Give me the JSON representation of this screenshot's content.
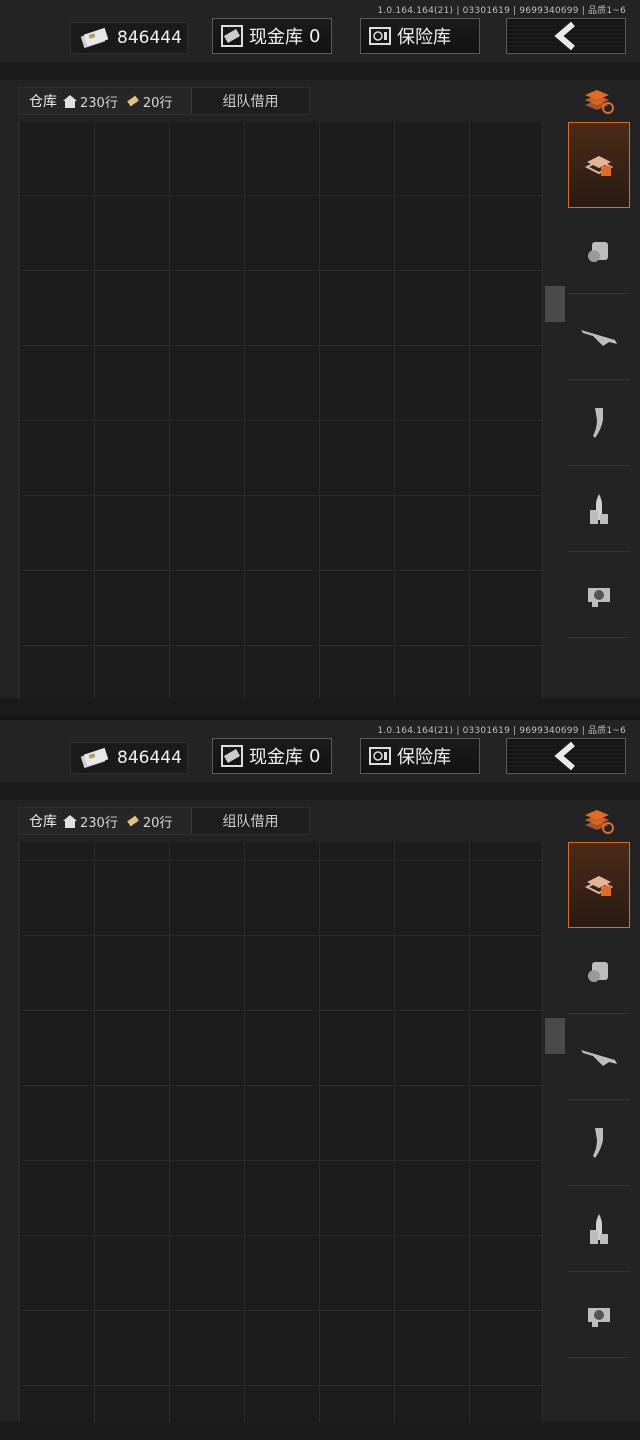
{
  "version": "1.0.164.164(21) | 03301619 | 9699340699 | 品质1~6",
  "money": "846444",
  "cash_label": "现金库",
  "cash_count": "0",
  "safe_label": "保险库",
  "warehouse_label": "仓库",
  "rows_home": "230行",
  "rows_extra": "20行",
  "team_label": "组队借用",
  "accent_color": "#d86a2b",
  "icons": {
    "money": "cash-stack-icon",
    "cash": "cash-vault-icon",
    "safe": "safe-icon",
    "back": "chevron-left-icon",
    "sort": "stack-refresh-icon",
    "categories": [
      "all-items-icon",
      "armor-helmet-icon",
      "rifle-icon",
      "magazine-icon",
      "ammo-icon",
      "optic-sight-icon"
    ]
  }
}
